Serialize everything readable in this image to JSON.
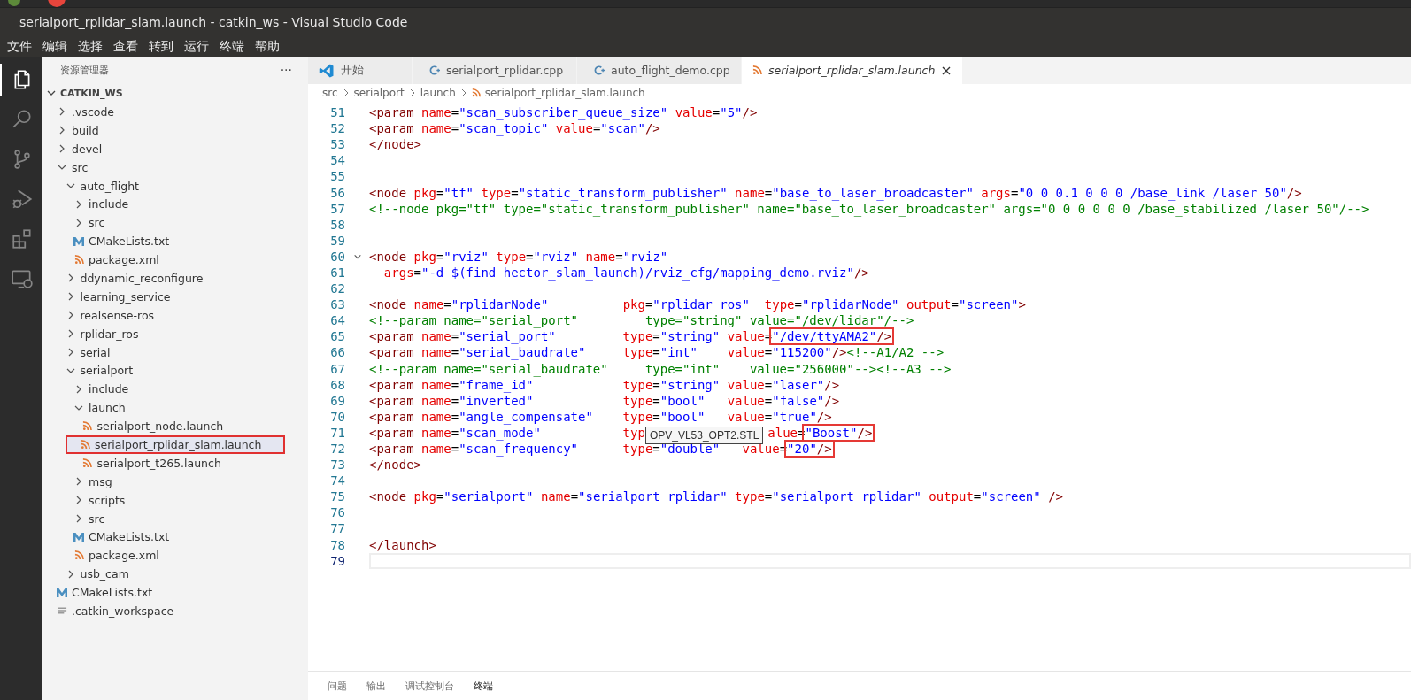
{
  "window": {
    "title": "serialport_rplidar_slam.launch - catkin_ws - Visual Studio Code"
  },
  "menu": [
    "文件",
    "编辑",
    "选择",
    "查看",
    "转到",
    "运行",
    "终端",
    "帮助"
  ],
  "activity_bar": [
    {
      "kind": "explorer",
      "selected": true
    },
    {
      "kind": "search",
      "selected": false
    },
    {
      "kind": "source-control",
      "selected": false
    },
    {
      "kind": "run-debug",
      "selected": false
    },
    {
      "kind": "extensions",
      "selected": false
    },
    {
      "kind": "remote",
      "selected": false
    }
  ],
  "explorer": {
    "title": "资源管理器",
    "more": "···",
    "workspace": {
      "name": "CATKIN_WS",
      "expanded": true
    },
    "items": [
      {
        "name": ".vscode",
        "kind": "folder",
        "expanded": false,
        "selected": false,
        "outlined": false
      },
      {
        "name": "build",
        "kind": "folder",
        "expanded": false,
        "selected": false,
        "outlined": false
      },
      {
        "name": "devel",
        "kind": "folder",
        "expanded": false,
        "selected": false,
        "outlined": false
      },
      {
        "name": "src",
        "kind": "folder",
        "expanded": true,
        "selected": false,
        "outlined": false,
        "children": [
          {
            "name": "auto_flight",
            "kind": "folder",
            "expanded": true,
            "selected": false,
            "outlined": false,
            "children": [
              {
                "name": "include",
                "kind": "folder",
                "expanded": false,
                "selected": false,
                "outlined": false
              },
              {
                "name": "src",
                "kind": "folder",
                "expanded": false,
                "selected": false,
                "outlined": false
              },
              {
                "name": "CMakeLists.txt",
                "kind": "cmake",
                "selected": false,
                "outlined": false
              },
              {
                "name": "package.xml",
                "kind": "xml",
                "selected": false,
                "outlined": false
              }
            ]
          },
          {
            "name": "ddynamic_reconfigure",
            "kind": "folder",
            "expanded": false,
            "selected": false,
            "outlined": false
          },
          {
            "name": "learning_service",
            "kind": "folder",
            "expanded": false,
            "selected": false,
            "outlined": false
          },
          {
            "name": "realsense-ros",
            "kind": "folder",
            "expanded": false,
            "selected": false,
            "outlined": false
          },
          {
            "name": "rplidar_ros",
            "kind": "folder",
            "expanded": false,
            "selected": false,
            "outlined": false
          },
          {
            "name": "serial",
            "kind": "folder",
            "expanded": false,
            "selected": false,
            "outlined": false
          },
          {
            "name": "serialport",
            "kind": "folder",
            "expanded": true,
            "selected": false,
            "outlined": false,
            "children": [
              {
                "name": "include",
                "kind": "folder",
                "expanded": false,
                "selected": false,
                "outlined": false
              },
              {
                "name": "launch",
                "kind": "folder",
                "expanded": true,
                "selected": false,
                "outlined": false,
                "children": [
                  {
                    "name": "serialport_node.launch",
                    "kind": "xml",
                    "selected": false,
                    "outlined": false
                  },
                  {
                    "name": "serialport_rplidar_slam.launch",
                    "kind": "xml",
                    "selected": true,
                    "outlined": true
                  },
                  {
                    "name": "serialport_t265.launch",
                    "kind": "xml",
                    "selected": false,
                    "outlined": false
                  }
                ]
              },
              {
                "name": "msg",
                "kind": "folder",
                "expanded": false,
                "selected": false,
                "outlined": false
              },
              {
                "name": "scripts",
                "kind": "folder",
                "expanded": false,
                "selected": false,
                "outlined": false
              },
              {
                "name": "src",
                "kind": "folder",
                "expanded": false,
                "selected": false,
                "outlined": false
              },
              {
                "name": "CMakeLists.txt",
                "kind": "cmake",
                "selected": false,
                "outlined": false
              },
              {
                "name": "package.xml",
                "kind": "xml",
                "selected": false,
                "outlined": false
              }
            ]
          },
          {
            "name": "usb_cam",
            "kind": "folder",
            "expanded": false,
            "selected": false,
            "outlined": false
          }
        ]
      },
      {
        "name": "CMakeLists.txt",
        "kind": "cmake",
        "selected": false,
        "outlined": false
      },
      {
        "name": ".catkin_workspace",
        "kind": "file",
        "selected": false,
        "outlined": false
      }
    ]
  },
  "tabs": [
    {
      "label": "开始",
      "kind": "welcome",
      "selected": false
    },
    {
      "label": "serialport_rplidar.cpp",
      "kind": "cpp",
      "selected": false
    },
    {
      "label": "auto_flight_demo.cpp",
      "kind": "cpp",
      "selected": false
    },
    {
      "label": "serialport_rplidar_slam.launch",
      "kind": "xml",
      "selected": true
    }
  ],
  "breadcrumb": [
    "src",
    "serialport",
    "launch",
    "serialport_rplidar_slam.launch"
  ],
  "code": [
    {
      "number": "51",
      "cursor": false,
      "segments": [
        {
          "kind": "code",
          "text": "<param name=\"scan_subscriber_queue_size\" value=\"5\"/>",
          "boxed": false
        }
      ]
    },
    {
      "number": "52",
      "cursor": false,
      "segments": [
        {
          "kind": "code",
          "text": "<param name=\"scan_topic\" value=\"scan\"/>",
          "boxed": false
        }
      ]
    },
    {
      "number": "53",
      "cursor": false,
      "segments": [
        {
          "kind": "code",
          "text": "</node>",
          "boxed": false
        }
      ]
    },
    {
      "number": "54",
      "cursor": false
    },
    {
      "number": "55",
      "cursor": false
    },
    {
      "number": "56",
      "cursor": false,
      "segments": [
        {
          "kind": "code",
          "text": "<node pkg=\"tf\" type=\"static_transform_publisher\" name=\"base_to_laser_broadcaster\" args=\"0 0 0.1 0 0 0 /base_link /laser 50\"/>",
          "boxed": false
        }
      ]
    },
    {
      "number": "57",
      "cursor": false,
      "segments": [
        {
          "kind": "comment",
          "text": "<!--node pkg=\"tf\" type=\"static_transform_publisher\" name=\"base_to_laser_broadcaster\" args=\"0 0 0 0 0 0 /base_stabilized /laser 50\"/-->",
          "boxed": false
        }
      ]
    },
    {
      "number": "58",
      "cursor": false
    },
    {
      "number": "59",
      "cursor": false
    },
    {
      "number": "60",
      "cursor": false,
      "expanded": true,
      "segments": [
        {
          "kind": "code",
          "text": "<node pkg=\"rviz\" type=\"rviz\" name=\"rviz\"",
          "boxed": false
        }
      ]
    },
    {
      "number": "61",
      "cursor": false,
      "segments": [
        {
          "kind": "code",
          "text": "  args=\"-d $(find hector_slam_launch)/rviz_cfg/mapping_demo.rviz\"/>",
          "boxed": false
        }
      ]
    },
    {
      "number": "62",
      "cursor": false
    },
    {
      "number": "63",
      "cursor": false,
      "segments": [
        {
          "kind": "code",
          "text": "<node name=\"rplidarNode\"",
          "boxed": false
        },
        {
          "kind": "code",
          "text": "          pkg=\"rplidar_ros\"",
          "boxed": false
        },
        {
          "kind": "code",
          "text": "  type=\"rplidarNode\" output=\"screen\">",
          "boxed": false
        }
      ]
    },
    {
      "number": "64",
      "cursor": false,
      "segments": [
        {
          "kind": "comment",
          "text": "<!--param name=\"serial_port\"",
          "boxed": false
        },
        {
          "kind": "comment",
          "text": "         type=\"string\" value=\"/dev/lidar\"/-->",
          "boxed": false
        }
      ]
    },
    {
      "number": "65",
      "cursor": false,
      "segments": [
        {
          "kind": "code",
          "text": "<param name=\"serial_port\"",
          "boxed": false
        },
        {
          "kind": "code",
          "text": "         type=\"string\" value=",
          "boxed": false
        },
        {
          "kind": "code",
          "text": "\"/dev/ttyAMA2\"/>",
          "boxed": true
        }
      ]
    },
    {
      "number": "66",
      "cursor": false,
      "segments": [
        {
          "kind": "code",
          "text": "<param name=\"serial_baudrate\"",
          "boxed": false
        },
        {
          "kind": "code",
          "text": "     type=\"int\"",
          "boxed": false
        },
        {
          "kind": "code",
          "text": "    value=\"115200\"/>",
          "boxed": false
        },
        {
          "kind": "comment",
          "text": "<!--A1/A2 -->",
          "boxed": false
        }
      ]
    },
    {
      "number": "67",
      "cursor": false,
      "segments": [
        {
          "kind": "comment",
          "text": "<!--param name=\"serial_baudrate\"",
          "boxed": false
        },
        {
          "kind": "comment",
          "text": "     type=\"int\"",
          "boxed": false
        },
        {
          "kind": "comment",
          "text": "    value=\"256000\"--><!--A3 -->",
          "boxed": false
        }
      ]
    },
    {
      "number": "68",
      "cursor": false,
      "segments": [
        {
          "kind": "code",
          "text": "<param name=\"frame_id\"",
          "boxed": false
        },
        {
          "kind": "code",
          "text": "            type=\"string\" value=\"laser\"/>",
          "boxed": false
        }
      ]
    },
    {
      "number": "69",
      "cursor": false,
      "segments": [
        {
          "kind": "code",
          "text": "<param name=\"inverted\"",
          "boxed": false
        },
        {
          "kind": "code",
          "text": "            type=\"bool\"",
          "boxed": false
        },
        {
          "kind": "code",
          "text": "   value=\"false\"/>",
          "boxed": false
        }
      ]
    },
    {
      "number": "70",
      "cursor": false,
      "segments": [
        {
          "kind": "code",
          "text": "<param name=\"angle_compensate\"",
          "boxed": false
        },
        {
          "kind": "code",
          "text": "    type=\"bool\"",
          "boxed": false
        },
        {
          "kind": "code",
          "text": "   value=\"true\"/>",
          "boxed": false
        }
      ]
    },
    {
      "number": "71",
      "cursor": false,
      "segments": [
        {
          "kind": "code",
          "text": "<param name=\"scan_mode\"",
          "boxed": false
        },
        {
          "kind": "attr",
          "text": "           typ",
          "boxed": false
        },
        {
          "kind": "tooltip",
          "text": "OPV_VL53_OPT2.STL"
        },
        {
          "kind": "code",
          "text": "alue=",
          "boxed": false
        },
        {
          "kind": "code",
          "text": "\"Boost\"/>",
          "boxed": true
        }
      ]
    },
    {
      "number": "72",
      "cursor": false,
      "segments": [
        {
          "kind": "code",
          "text": "<param name=\"scan_frequency\"",
          "boxed": false
        },
        {
          "kind": "code",
          "text": "      type=\"double\"",
          "boxed": false
        },
        {
          "kind": "code",
          "text": "   value=",
          "boxed": false
        },
        {
          "kind": "code",
          "text": "\"20\"/>",
          "boxed": true
        }
      ]
    },
    {
      "number": "73",
      "cursor": false,
      "segments": [
        {
          "kind": "code",
          "text": "</node>",
          "boxed": false
        }
      ]
    },
    {
      "number": "74",
      "cursor": false
    },
    {
      "number": "75",
      "cursor": false,
      "segments": [
        {
          "kind": "code",
          "text": "<node pkg=\"serialport\" name=\"serialport_rplidar\" type=\"serialport_rplidar\" output=\"screen\" />",
          "boxed": false
        }
      ]
    },
    {
      "number": "76",
      "cursor": false
    },
    {
      "number": "77",
      "cursor": false
    },
    {
      "number": "78",
      "cursor": false,
      "segments": [
        {
          "kind": "code",
          "text": "</launch>",
          "boxed": false
        }
      ]
    },
    {
      "number": "79",
      "cursor": true
    }
  ],
  "panel_tabs": [
    {
      "label": "问题",
      "selected": false
    },
    {
      "label": "输出",
      "selected": false
    },
    {
      "label": "调试控制台",
      "selected": false
    },
    {
      "label": "终端",
      "selected": true
    }
  ]
}
